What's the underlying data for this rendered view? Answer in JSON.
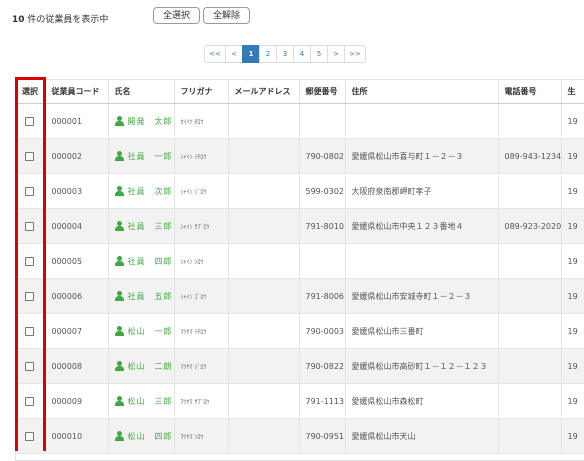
{
  "status": {
    "count": "10",
    "suffix": " 件の従業員を表示中"
  },
  "buttons": {
    "select_all": "全選択",
    "deselect_all": "全解除"
  },
  "pagination": {
    "first": "<<",
    "prev": "<",
    "pages": [
      "1",
      "2",
      "3",
      "4",
      "5"
    ],
    "next": ">",
    "last": ">>",
    "active": "1"
  },
  "table": {
    "headers": [
      "選択",
      "従業員コード",
      "氏名",
      "フリガナ",
      "メールアドレス",
      "郵便番号",
      "住所",
      "電話番号",
      "生"
    ],
    "rows": [
      {
        "code": "000001",
        "name": "開発　太郎",
        "furigana": "ｶｲﾊﾂ ﾀﾛｳ",
        "email": "",
        "postal": "",
        "address": "",
        "phone": "",
        "birth": "19"
      },
      {
        "code": "000002",
        "name": "社員　一郎",
        "furigana": "ｼｬｲﾝ ｲﾁﾛｳ",
        "email": "",
        "postal": "790-0802",
        "address": "愛媛県松山市喜与町１－２－３",
        "phone": "089-943-1234",
        "birth": "19"
      },
      {
        "code": "000003",
        "name": "社員　次郎",
        "furigana": "ｼｬｲﾝ ｼﾞﾛｳ",
        "email": "",
        "postal": "599-0302",
        "address": "大阪府泉南郡岬町孝子",
        "phone": "",
        "birth": "19"
      },
      {
        "code": "000004",
        "name": "社員　三郎",
        "furigana": "ｼｬｲﾝ ｻﾌﾞﾛｳ",
        "email": "",
        "postal": "791-8010",
        "address": "愛媛県松山市中央１２３番地４",
        "phone": "089-923-2020",
        "birth": "19"
      },
      {
        "code": "000005",
        "name": "社員　四郎",
        "furigana": "ｼｬｲﾝ ｼﾛｳ",
        "email": "",
        "postal": "",
        "address": "",
        "phone": "",
        "birth": "19"
      },
      {
        "code": "000006",
        "name": "社員　五郎",
        "furigana": "ｼｬｲﾝ ｺﾞﾛｳ",
        "email": "",
        "postal": "791-8006",
        "address": "愛媛県松山市安城寺町１－２－３",
        "phone": "",
        "birth": "19"
      },
      {
        "code": "000007",
        "name": "松山　一郎",
        "furigana": "ﾏﾂﾔﾏ ｲﾁﾛｳ",
        "email": "",
        "postal": "790-0003",
        "address": "愛媛県松山市三番町",
        "phone": "",
        "birth": "19"
      },
      {
        "code": "000008",
        "name": "松山　二朗",
        "furigana": "ﾏﾂﾔﾏ ｼﾞﾛｳ",
        "email": "",
        "postal": "790-0822",
        "address": "愛媛県松山市高砂町１－１２－１２３",
        "phone": "",
        "birth": "19"
      },
      {
        "code": "000009",
        "name": "松山　三郎",
        "furigana": "ﾏﾂﾔﾏ ｻﾌﾞﾛｳ",
        "email": "",
        "postal": "791-1113",
        "address": "愛媛県松山市森松町",
        "phone": "",
        "birth": "19"
      },
      {
        "code": "000010",
        "name": "松山　四郎",
        "furigana": "ﾏﾂﾔﾏ ｼﾛｳ",
        "email": "",
        "postal": "790-0951",
        "address": "愛媛県松山市天山",
        "phone": "",
        "birth": "19"
      }
    ]
  },
  "colors": {
    "accent": "#337ab7",
    "name_green": "#3fa842",
    "highlight_red": "#dd0000"
  }
}
